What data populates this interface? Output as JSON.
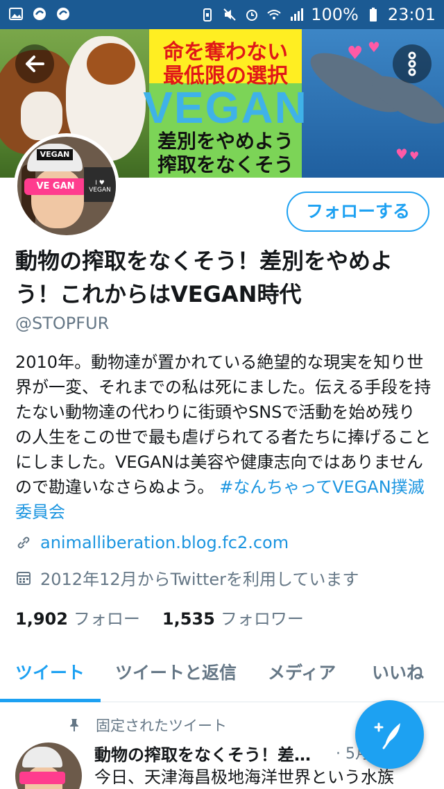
{
  "status_bar": {
    "battery": "100%",
    "time": "23:01"
  },
  "banner": {
    "line1": "命を奪わない",
    "line2": "最低限の選択",
    "line3": "VEGAN",
    "line4": "差別をやめよう",
    "line5": "搾取をなくそう",
    "avatar_hat_label": "VEGAN",
    "avatar_glasses_label": "VE  GAN",
    "avatar_screen_label": "I ♥ VEGAN"
  },
  "profile": {
    "follow_button": "フォローする",
    "name": "動物の搾取をなくそう！差別をやめよう！これからはVEGAN時代",
    "handle": "@STOPFUR",
    "bio_text": "2010年。動物達が置かれている絶望的な現実を知り世界が一変、それまでの私は死にました。伝える手段を持たない動物達の代わりに街頭やSNSで活動を始め残りの人生をこの世で最も虐げられてる者たちに捧げることにしました。VEGANは美容や健康志向ではありませんので勘違いなさらぬよう。 ",
    "bio_hashtag": "#なんちゃってVEGAN撲滅委員会",
    "link": "animalliberation.blog.fc2.com",
    "joined": "2012年12月からTwitterを利用しています",
    "following_count": "1,902",
    "following_label": "フォロー",
    "followers_count": "1,535",
    "followers_label": "フォロワー"
  },
  "tabs": [
    "ツイート",
    "ツイートと返信",
    "メディア",
    "いいね"
  ],
  "pinned_tweet": {
    "pinned_label": "固定されたツイート",
    "name": "動物の搾取をなくそう！差…",
    "date": "· 5月",
    "text": "今日、天津海昌极地海洋世界という水族"
  },
  "colors": {
    "status_bar": "#1b5a93",
    "accent": "#1da1f2",
    "link": "#1b95e0",
    "secondary_text": "#657786"
  },
  "icons": {
    "back": "arrow-left-icon",
    "more": "more-vertical-icon",
    "link": "link-icon",
    "calendar": "calendar-icon",
    "pin": "pin-icon",
    "compose": "compose-tweet-icon"
  }
}
